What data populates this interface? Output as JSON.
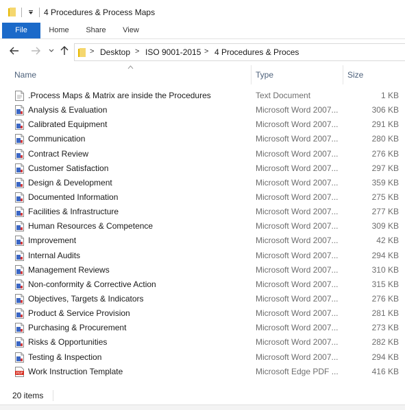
{
  "window": {
    "title": "4 Procedures & Process Maps",
    "qat_icon": "dropdown-arrow"
  },
  "ribbon": {
    "tabs": [
      "File",
      "Home",
      "Share",
      "View"
    ]
  },
  "address": {
    "back_icon": "arrow-left",
    "forward_icon": "arrow-right",
    "up_icon": "arrow-up",
    "separator": ">",
    "crumbs": [
      "Desktop",
      "ISO 9001-2015",
      "4 Procedures & Proces"
    ]
  },
  "columns": {
    "name": "Name",
    "type": "Type",
    "size": "Size"
  },
  "files": [
    {
      "name": ".Process Maps & Matrix are inside the Procedures",
      "type": "Text Document",
      "size": "1 KB",
      "icon": "text-doc-icon"
    },
    {
      "name": "Analysis & Evaluation",
      "type": "Microsoft Word 2007...",
      "size": "306 KB",
      "icon": "word-doc-icon"
    },
    {
      "name": "Calibrated Equipment",
      "type": "Microsoft Word 2007...",
      "size": "291 KB",
      "icon": "word-doc-icon"
    },
    {
      "name": "Communication",
      "type": "Microsoft Word 2007...",
      "size": "280 KB",
      "icon": "word-doc-icon"
    },
    {
      "name": "Contract Review",
      "type": "Microsoft Word 2007...",
      "size": "276 KB",
      "icon": "word-doc-icon"
    },
    {
      "name": "Customer Satisfaction",
      "type": "Microsoft Word 2007...",
      "size": "297 KB",
      "icon": "word-doc-icon"
    },
    {
      "name": "Design & Development",
      "type": "Microsoft Word 2007...",
      "size": "359 KB",
      "icon": "word-doc-icon"
    },
    {
      "name": "Documented Information",
      "type": "Microsoft Word 2007...",
      "size": "275 KB",
      "icon": "word-doc-icon"
    },
    {
      "name": "Facilities & Infrastructure",
      "type": "Microsoft Word 2007...",
      "size": "277 KB",
      "icon": "word-doc-icon"
    },
    {
      "name": "Human Resources & Competence",
      "type": "Microsoft Word 2007...",
      "size": "309 KB",
      "icon": "word-doc-icon"
    },
    {
      "name": "Improvement",
      "type": "Microsoft Word 2007...",
      "size": "42 KB",
      "icon": "word-doc-icon"
    },
    {
      "name": "Internal Audits",
      "type": "Microsoft Word 2007...",
      "size": "294 KB",
      "icon": "word-doc-icon"
    },
    {
      "name": "Management Reviews",
      "type": "Microsoft Word 2007...",
      "size": "310 KB",
      "icon": "word-doc-icon"
    },
    {
      "name": "Non-conformity & Corrective Action",
      "type": "Microsoft Word 2007...",
      "size": "315 KB",
      "icon": "word-doc-icon"
    },
    {
      "name": "Objectives, Targets & Indicators",
      "type": "Microsoft Word 2007...",
      "size": "276 KB",
      "icon": "word-doc-icon"
    },
    {
      "name": "Product & Service Provision",
      "type": "Microsoft Word 2007...",
      "size": "281 KB",
      "icon": "word-doc-icon"
    },
    {
      "name": "Purchasing & Procurement",
      "type": "Microsoft Word 2007...",
      "size": "273 KB",
      "icon": "word-doc-icon"
    },
    {
      "name": "Risks & Opportunities",
      "type": "Microsoft Word 2007...",
      "size": "282 KB",
      "icon": "word-doc-icon"
    },
    {
      "name": "Testing & Inspection",
      "type": "Microsoft Word 2007...",
      "size": "294 KB",
      "icon": "word-doc-icon"
    },
    {
      "name": "Work Instruction Template",
      "type": "Microsoft Edge PDF ...",
      "size": "416 KB",
      "icon": "pdf-doc-icon"
    }
  ],
  "status": {
    "count": "20 items"
  },
  "colors": {
    "accent": "#1b6ac9",
    "folder": "#f2c94c",
    "header_text": "#4c607a",
    "secondary_text": "#6d6d6d"
  }
}
